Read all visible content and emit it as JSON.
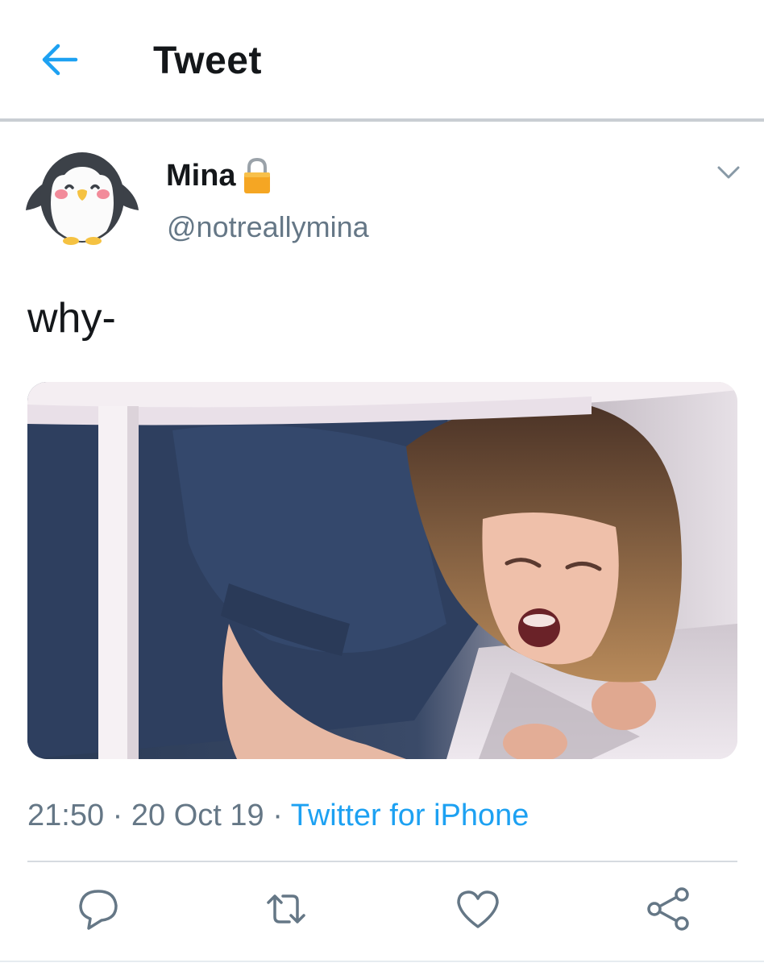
{
  "header": {
    "title": "Tweet",
    "back_icon": "arrow-left-icon",
    "accent_color": "#1da1f2"
  },
  "tweet": {
    "author_name": "Mina",
    "author_handle": "@notreallymina",
    "protected_icon": "lock-icon",
    "avatar": "penguin-avatar",
    "text": "why-",
    "media_description": "photo",
    "time": "21:50",
    "date": "20 Oct 19",
    "separator": "·",
    "source": "Twitter for iPhone",
    "source_color": "#1da1f2",
    "menu_icon": "chevron-down-icon"
  },
  "actions": [
    {
      "name": "reply",
      "icon": "reply-icon"
    },
    {
      "name": "retweet",
      "icon": "retweet-icon"
    },
    {
      "name": "like",
      "icon": "heart-icon"
    },
    {
      "name": "share",
      "icon": "share-icon"
    }
  ]
}
